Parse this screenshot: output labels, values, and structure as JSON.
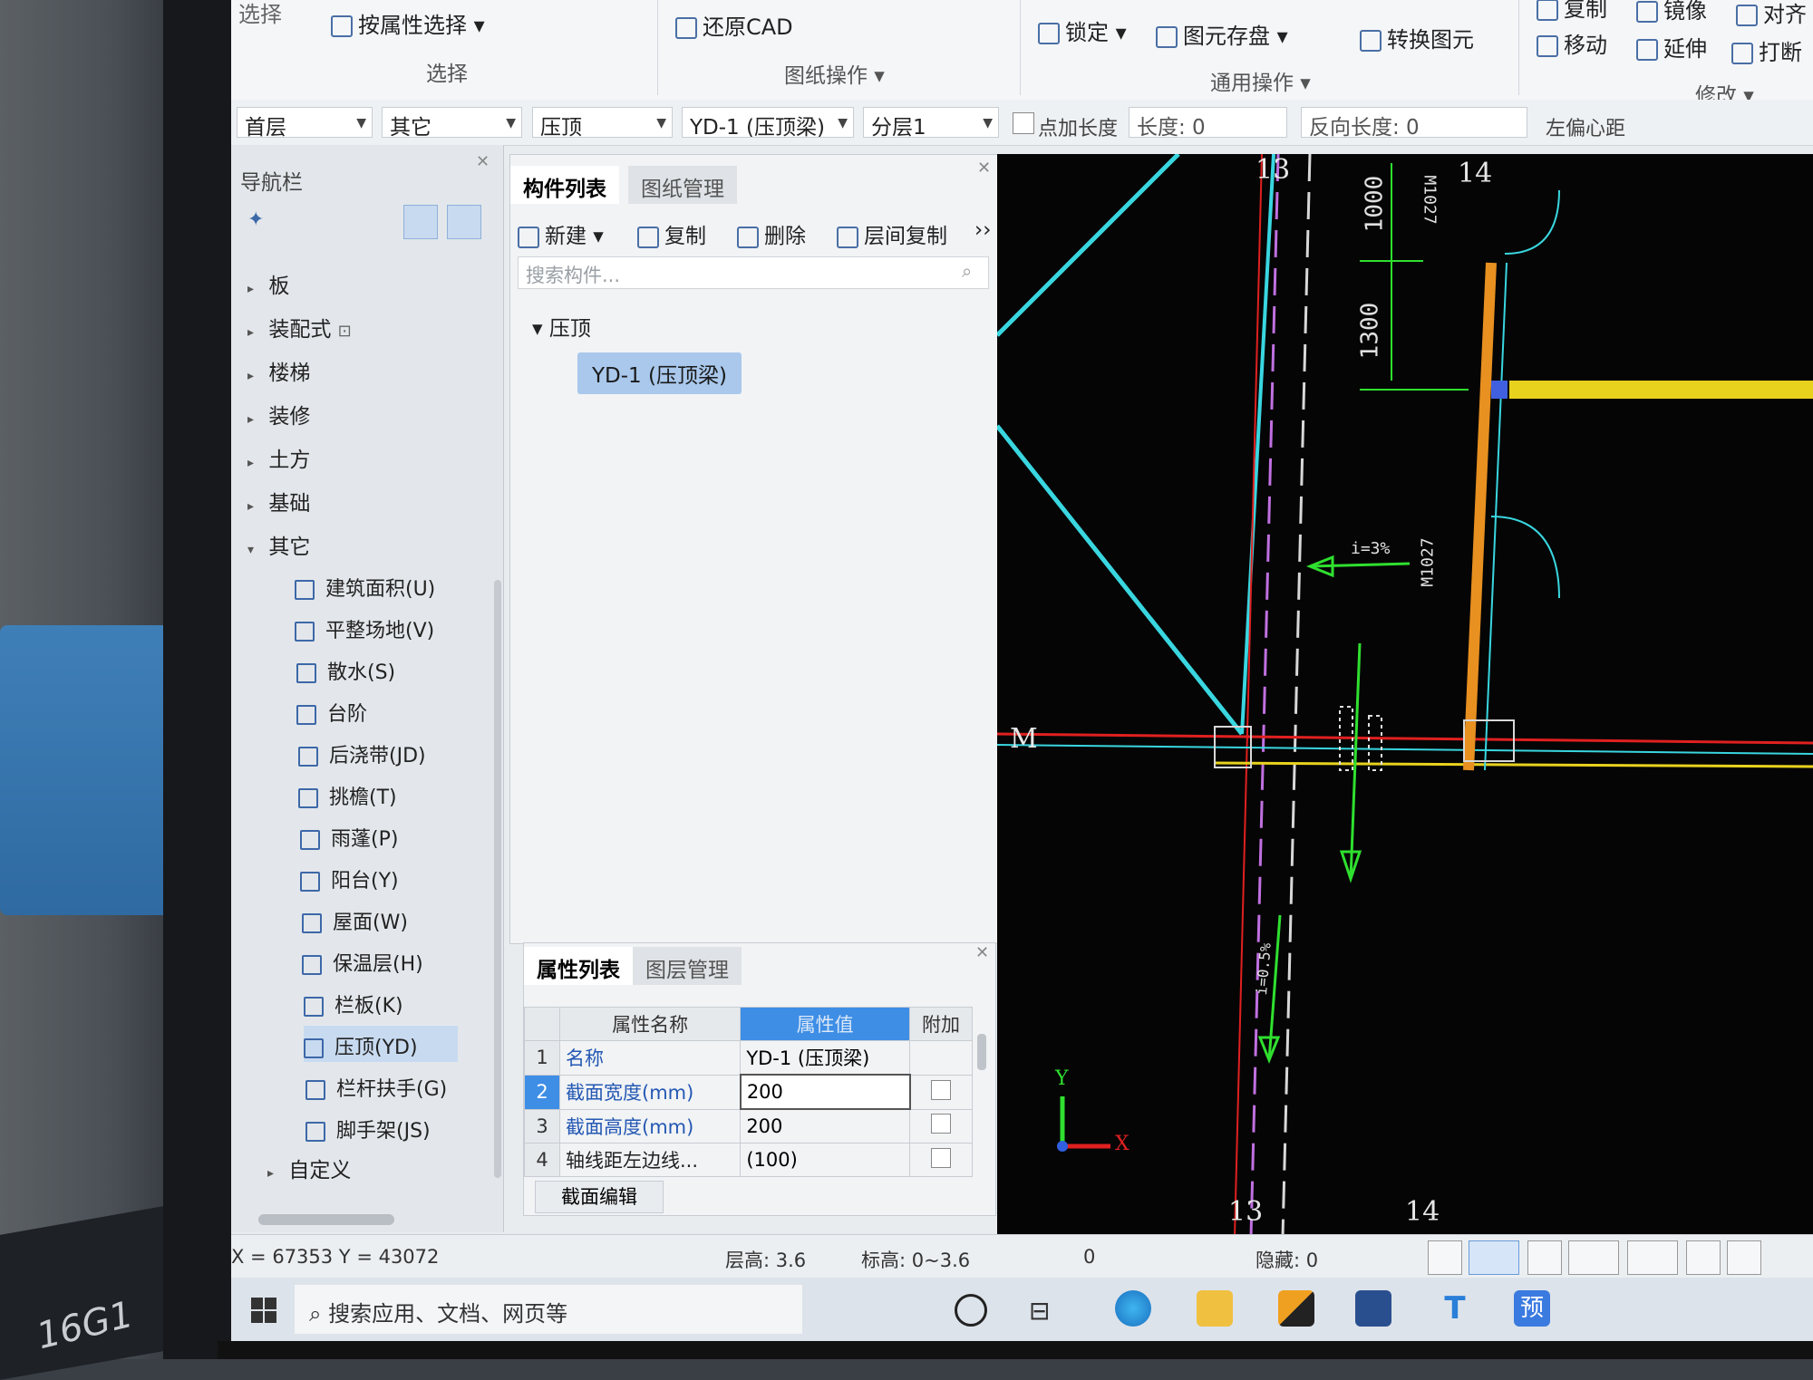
{
  "ribbon": {
    "select_by_attr": "按属性选择",
    "select_group": "选择",
    "restore_cad": "还原CAD",
    "drawing_ops": "图纸操作",
    "lock": "锁定",
    "save_element": "图元存盘",
    "convert_element": "转换图元",
    "general_ops": "通用操作",
    "copy": "复制",
    "mirror": "镜像",
    "align": "对齐",
    "move": "移动",
    "extend": "延伸",
    "break": "打断",
    "modify": "修改",
    "top_left_partial": "选择"
  },
  "dropbar": {
    "floor": "首层",
    "category": "其它",
    "type": "压顶",
    "component": "YD-1 (压顶梁)",
    "layer": "分层1",
    "add_length_label": "点加长度",
    "length_label": "长度: 0",
    "reverse_length": "反向长度: 0",
    "left_offset": "左偏心距"
  },
  "nav": {
    "title": "导航栏",
    "categories": [
      {
        "label": "板"
      },
      {
        "label": "装配式"
      },
      {
        "label": "楼梯"
      },
      {
        "label": "装修"
      },
      {
        "label": "土方"
      },
      {
        "label": "基础"
      },
      {
        "label": "其它"
      }
    ],
    "leaves": [
      {
        "label": "建筑面积(U)"
      },
      {
        "label": "平整场地(V)"
      },
      {
        "label": "散水(S)"
      },
      {
        "label": "台阶"
      },
      {
        "label": "后浇带(JD)"
      },
      {
        "label": "挑檐(T)"
      },
      {
        "label": "雨蓬(P)"
      },
      {
        "label": "阳台(Y)"
      },
      {
        "label": "屋面(W)"
      },
      {
        "label": "保温层(H)"
      },
      {
        "label": "栏板(K)"
      },
      {
        "label": "压顶(YD)"
      },
      {
        "label": "栏杆扶手(G)"
      },
      {
        "label": "脚手架(JS)"
      }
    ],
    "custom": "自定义"
  },
  "complist": {
    "tab_list": "构件列表",
    "tab_drawings": "图纸管理",
    "new": "新建",
    "copy": "复制",
    "delete": "删除",
    "floor_copy": "层间复制",
    "search_placeholder": "搜索构件...",
    "category": "压顶",
    "selected_item": "YD-1 (压顶梁)"
  },
  "props": {
    "tab_props": "属性列表",
    "tab_layers": "图层管理",
    "col_name": "属性名称",
    "col_value": "属性值",
    "col_extra": "附加",
    "rows": [
      {
        "n": "1",
        "name": "名称",
        "value": "YD-1 (压顶梁)"
      },
      {
        "n": "2",
        "name": "截面宽度(mm)",
        "value": "200"
      },
      {
        "n": "3",
        "name": "截面高度(mm)",
        "value": "200"
      },
      {
        "n": "4",
        "name": "轴线距左边线...",
        "value": "(100)"
      }
    ],
    "section_edit": "截面编辑"
  },
  "cad": {
    "axis_13_top": "13",
    "axis_14_top": "14",
    "axis_13_bottom": "13",
    "axis_14_bottom": "14",
    "axis_m": "M",
    "dim_1000": "1000",
    "dim_1300": "1300",
    "door_top": "M1027",
    "door_mid": "M1027",
    "slope_3": "i=3%",
    "slope_05": "i=0.5%",
    "axis_x": "X",
    "axis_y": "Y",
    "colors": {
      "cyan": "#39d6e0",
      "red": "#e02020",
      "yellow": "#e8d21e",
      "green": "#2fe02f",
      "magenta": "#c070e0"
    }
  },
  "status": {
    "coords": "X = 67353 Y = 43072",
    "floor_height": "层高:  3.6",
    "elevation": "标高:  0~3.6",
    "zero": "0",
    "hidden": "隐藏: 0"
  },
  "taskbar": {
    "search": "搜索应用、文档、网页等",
    "yu": "预"
  },
  "desk": {
    "book_text": "16G1"
  }
}
